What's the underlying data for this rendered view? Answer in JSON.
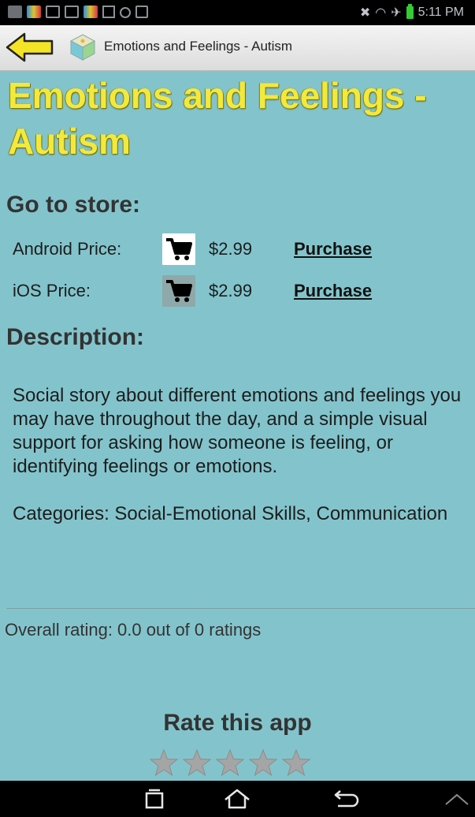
{
  "status_bar": {
    "time": "5:11 PM",
    "left_icons": [
      "gallery-icon",
      "app-notification-icon",
      "email-icon",
      "gmail-icon",
      "app-notification-icon",
      "upload-icon",
      "sync-icon",
      "clipboard-icon"
    ],
    "right_icons": [
      "mute-icon",
      "wifi-icon",
      "airplane-icon",
      "battery-icon"
    ]
  },
  "action_bar": {
    "title": "Emotions and Feelings - Autism",
    "back_icon": "back-arrow-icon",
    "app_icon": "cube-app-icon"
  },
  "page": {
    "title": "Emotions and Feelings - Autism",
    "store_heading": "Go to store:",
    "stores": [
      {
        "label": "Android Price:",
        "price": "$2.99",
        "action": "Purchase",
        "icon": "cart-icon"
      },
      {
        "label": "iOS Price:",
        "price": "$2.99",
        "action": "Purchase",
        "icon": "cart-icon"
      }
    ],
    "description_heading": "Description:",
    "description": "Social story about different emotions and feelings you may have throughout the day, and a simple visual support for asking how someone is feeling, or identifying feelings or emotions.",
    "categories": "Categories: Social-Emotional Skills, Communication",
    "rating_summary": "Overall rating: 0.0 out of 0 ratings",
    "rate_title": "Rate this app",
    "stars_total": 5,
    "stars_selected": 0
  },
  "nav_bar": {
    "buttons": [
      "recent-apps-icon",
      "home-icon",
      "back-icon",
      "menu-up-icon"
    ]
  },
  "colors": {
    "background": "#83c4cc",
    "title_yellow": "#f3e93d",
    "action_bar": "#e6e6e6",
    "star_empty": "#a5a5a5"
  }
}
